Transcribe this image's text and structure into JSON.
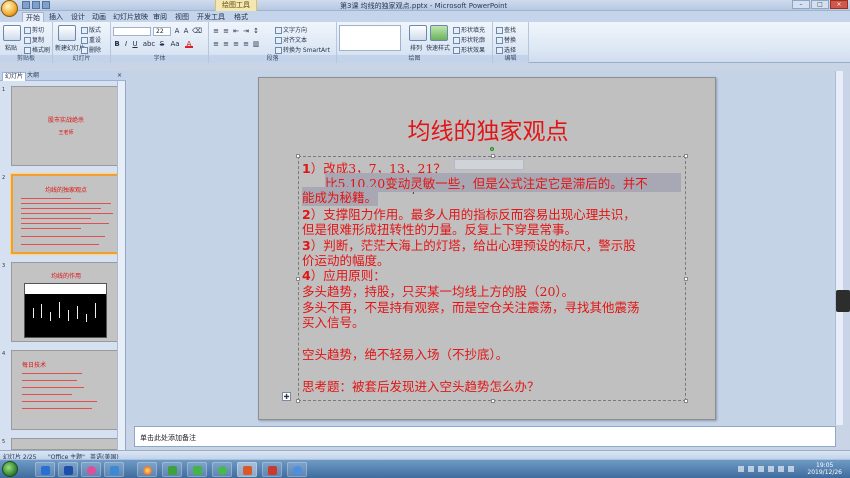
{
  "window": {
    "title": "第3课 均线的独家观点.pptx - Microsoft PowerPoint",
    "context_tab": "绘图工具",
    "controls": [
      "–",
      "□",
      "×"
    ]
  },
  "ribbon_tabs": [
    "开始",
    "插入",
    "设计",
    "动画",
    "幻灯片放映",
    "审阅",
    "视图",
    "开发工具",
    "格式"
  ],
  "ribbon": {
    "clipboard": {
      "paste": "粘贴",
      "cut": "剪切",
      "copy": "复制",
      "format_painter": "格式刷",
      "label": "剪贴板"
    },
    "slides": {
      "new_slide": "新建幻灯片",
      "layout": "版式",
      "reset": "重设",
      "delete": "删除",
      "label": "幻灯片"
    },
    "font": {
      "size": "22",
      "label": "字体",
      "bold": "B",
      "italic": "I",
      "underline": "U",
      "strike": "S",
      "shadow": "abc",
      "color": "A",
      "change_case": "Aa"
    },
    "paragraph": {
      "text_direction": "文字方向",
      "align_text": "对齐文本",
      "smartart": "转换为 SmartArt",
      "label": "段落"
    },
    "drawing": {
      "arrange": "排列",
      "quick_styles": "快速样式",
      "fill": "形状填充",
      "outline": "形状轮廓",
      "effects": "形状效果",
      "label": "绘图"
    },
    "editing": {
      "find": "查找",
      "replace": "替换",
      "select": "选择",
      "label": "编辑"
    }
  },
  "left_panel": {
    "tabs": [
      "幻灯片",
      "大纲"
    ],
    "thumbnails": [
      {
        "num": "1",
        "title": "股市实战绝杀",
        "sub": "王老师"
      },
      {
        "num": "2",
        "title": "均线的独家观点"
      },
      {
        "num": "3",
        "title": "均线的作用"
      },
      {
        "num": "4",
        "title": "每日技术"
      },
      {
        "num": "5",
        "title": ""
      }
    ]
  },
  "slide": {
    "title": "均线的独家观点",
    "paragraphs": [
      {
        "prefix": "1",
        "text": "）改成3，7，13，21？"
      },
      {
        "text": "比5,10,20变动灵敏一些，但是公式注定它是滞后的。并不"
      },
      {
        "text": "能成为秘籍。"
      },
      {
        "prefix": "2",
        "text": "）支撑阻力作用。最多人用的指标反而容易出现心理共识，"
      },
      {
        "text": "但是很难形成扭转性的力量。反复上下穿是常事。"
      },
      {
        "prefix": "3",
        "text": "）判断，茫茫大海上的灯塔，给出心理预设的标尺，警示股"
      },
      {
        "text": "价运动的幅度。"
      },
      {
        "prefix": "4",
        "text": "）应用原则："
      },
      {
        "text": "多头趋势，持股，只买某一均线上方的股（20）。"
      },
      {
        "text": "多头不再，不是持有观察，而是空仓关注震荡，寻找其他震荡"
      },
      {
        "text": "买入信号。"
      },
      {
        "text": "空头趋势，绝不轻易入场（不抄底）。"
      },
      {
        "text": "思考题：被套后发现进入空头趋势怎么办？"
      }
    ]
  },
  "notes": {
    "placeholder": "单击此处添加备注"
  },
  "status": {
    "slide_info": "幻灯片 2/25",
    "theme": "\"Office 主题\"",
    "language": "英语(美国)",
    "zoom": ""
  },
  "taskbar": {
    "time": "19:05",
    "date": "2019/12/26"
  },
  "watermark": "5850313"
}
